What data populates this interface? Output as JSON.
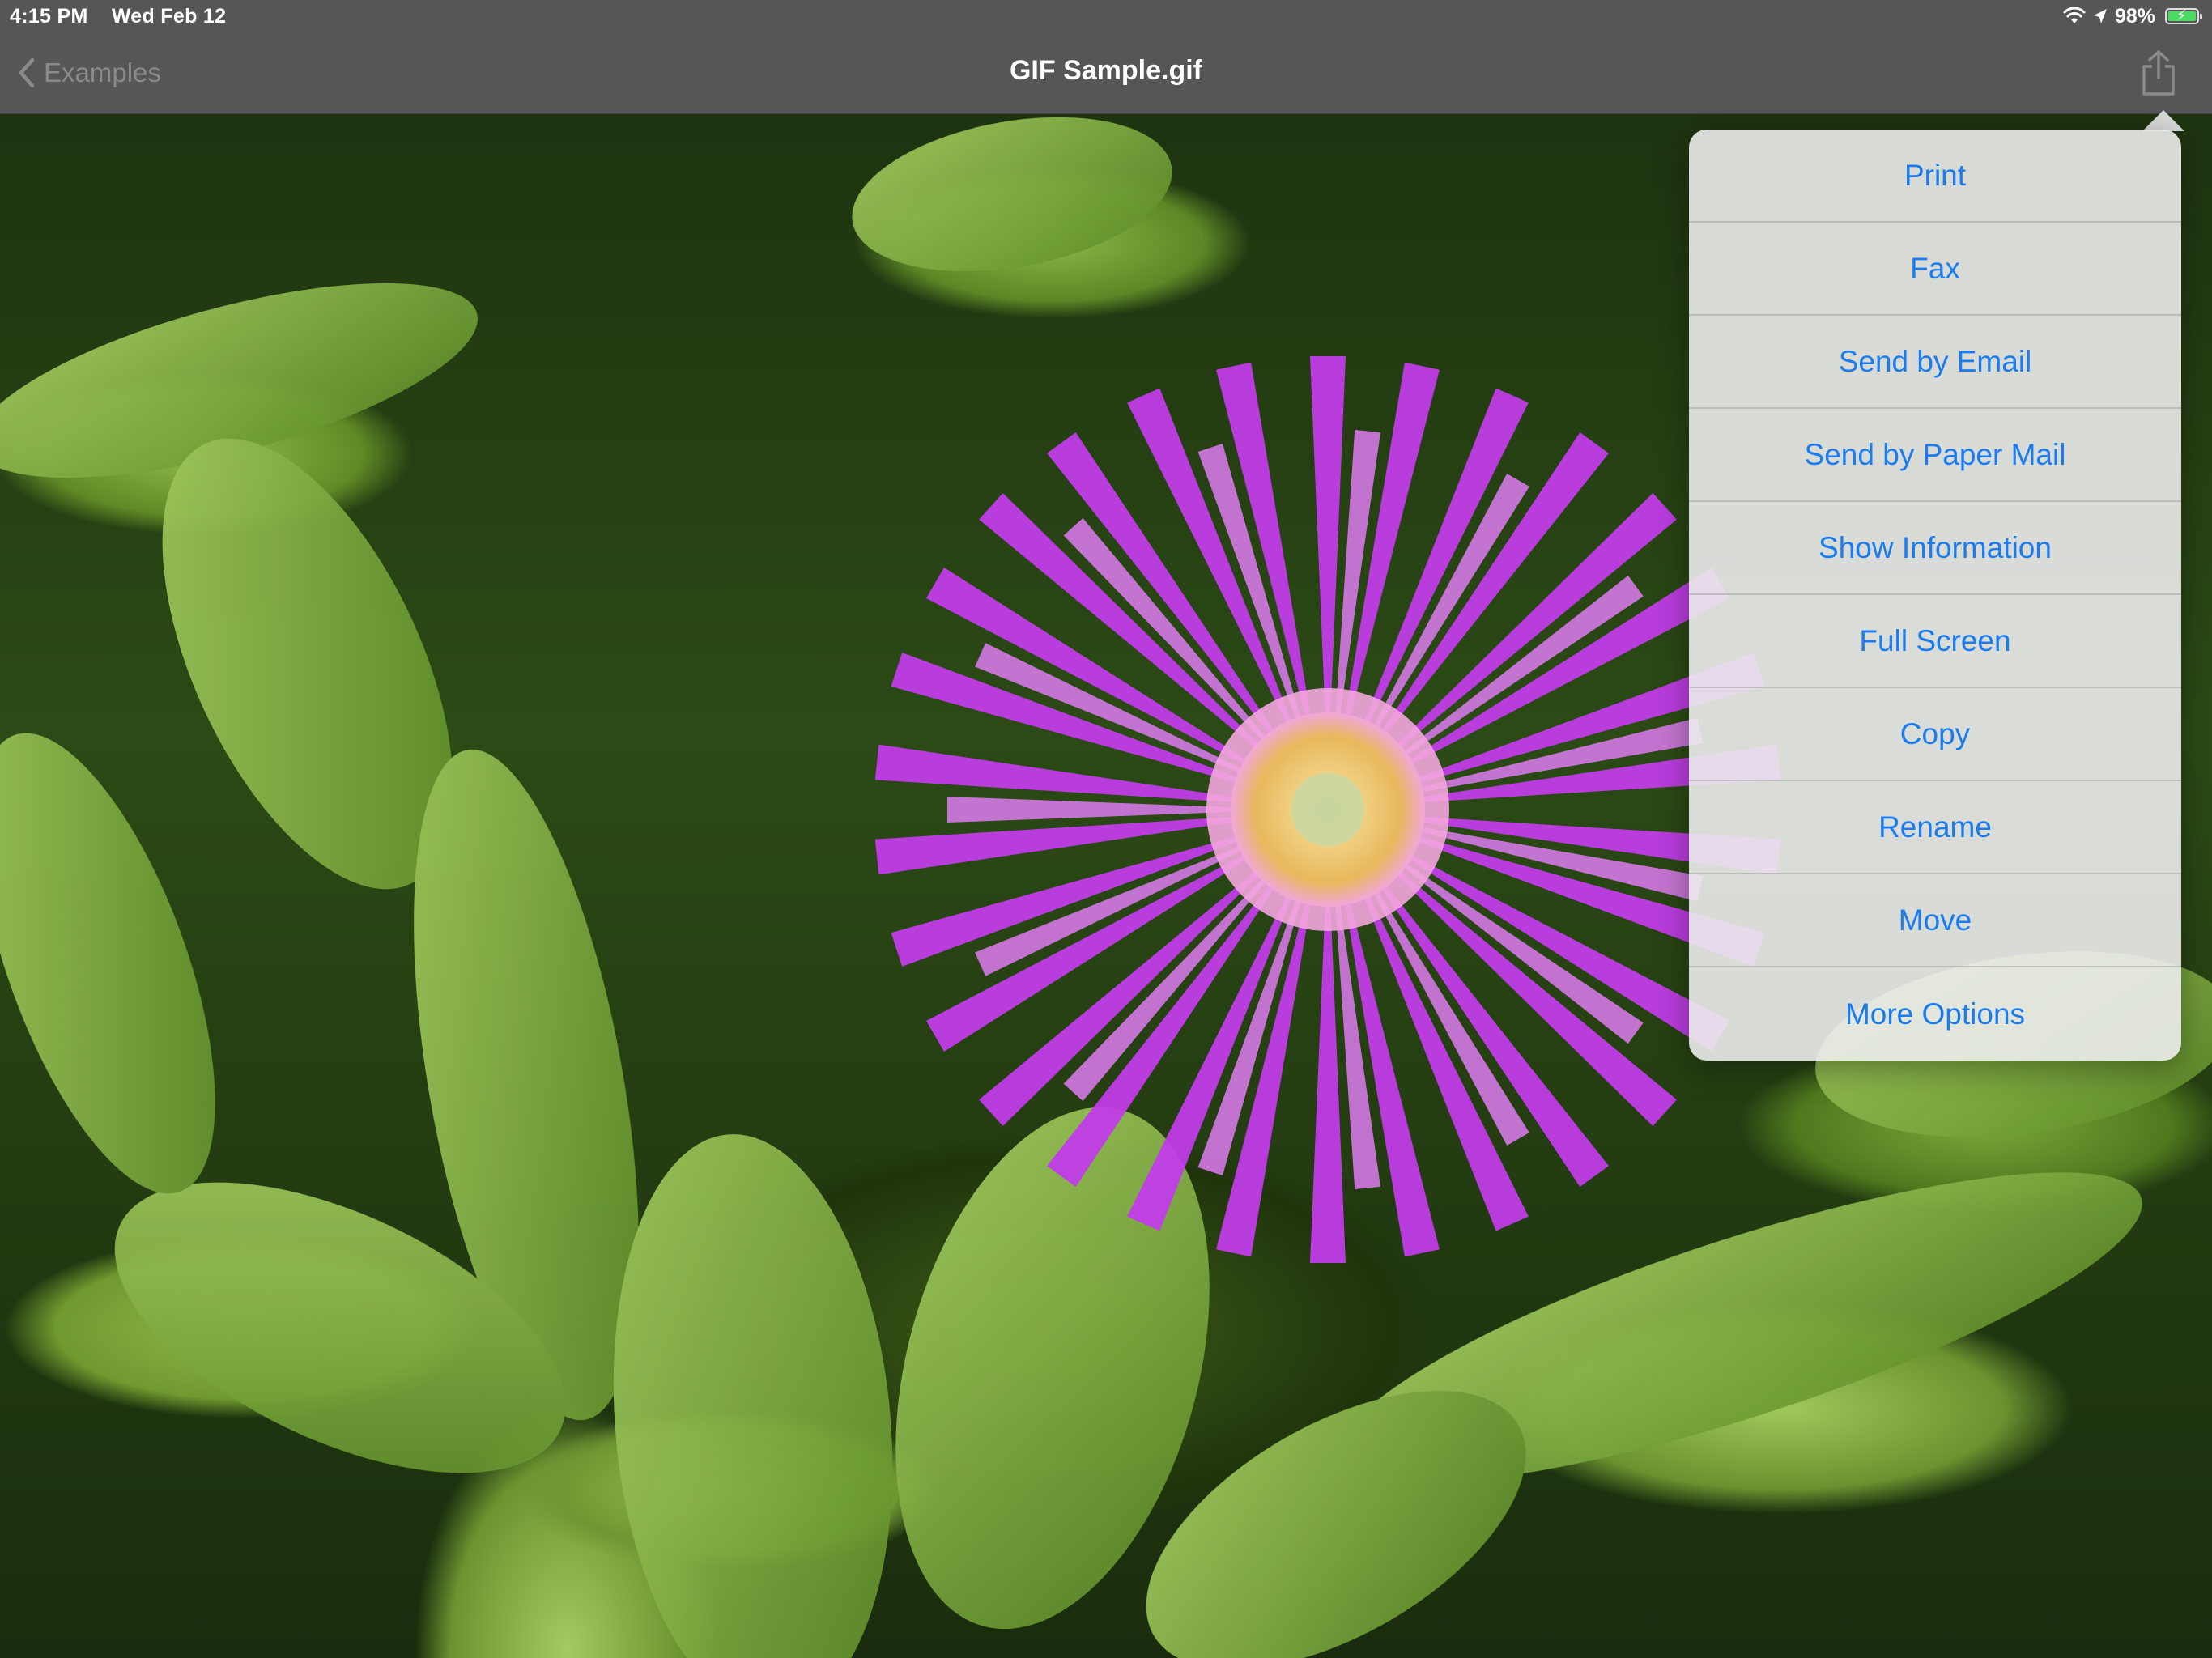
{
  "status_bar": {
    "time": "4:15 PM",
    "date": "Wed Feb 12",
    "battery": "98%",
    "battery_level": 0.98,
    "icons": [
      "wifi-icon",
      "location-arrow-icon",
      "battery-charging-icon"
    ]
  },
  "nav": {
    "back_label": "Examples",
    "title": "GIF Sample.gif",
    "share_icon": "share-icon"
  },
  "menu": {
    "items": [
      {
        "label": "Print"
      },
      {
        "label": "Fax"
      },
      {
        "label": "Send by Email"
      },
      {
        "label": "Send by Paper Mail"
      },
      {
        "label": "Show Information"
      },
      {
        "label": "Full Screen"
      },
      {
        "label": "Copy"
      },
      {
        "label": "Rename"
      },
      {
        "label": "Move"
      },
      {
        "label": "More Options"
      }
    ]
  },
  "colors": {
    "accent": "#1a7cf0",
    "bar": "#585858",
    "petal": "#c13de8",
    "flower_center": "#e8b85c"
  }
}
